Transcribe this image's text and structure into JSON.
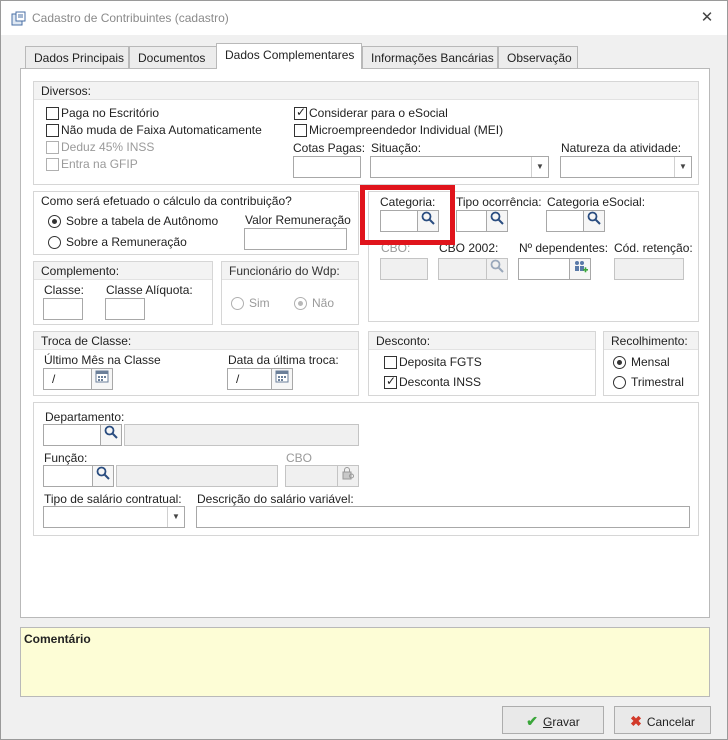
{
  "window": {
    "title": "Cadastro de Contribuintes (cadastro)",
    "close": "✕"
  },
  "tabs": [
    {
      "label": "Dados Principais",
      "active": false
    },
    {
      "label": "Documentos",
      "active": false
    },
    {
      "label": "Dados Complementares",
      "active": true
    },
    {
      "label": "Informações Bancárias",
      "active": false
    },
    {
      "label": "Observação",
      "active": false
    }
  ],
  "diversos": {
    "title": "Diversos:",
    "checkboxes": [
      {
        "label": "Paga no Escritório",
        "checked": false,
        "enabled": true
      },
      {
        "label": "Não muda de Faixa Automaticamente",
        "checked": false,
        "enabled": true
      },
      {
        "label": "Deduz 45% INSS",
        "checked": false,
        "enabled": false
      },
      {
        "label": "Entra na GFIP",
        "checked": false,
        "enabled": false
      },
      {
        "label": "Considerar para o eSocial",
        "checked": true,
        "enabled": true
      },
      {
        "label": "Microempreendedor Individual (MEI)",
        "checked": false,
        "enabled": true
      }
    ],
    "cotas_label": "Cotas Pagas:",
    "situacao_label": "Situação:",
    "natureza_label": "Natureza da atividade:"
  },
  "calculo": {
    "title": "Como será efetuado o cálculo da contribuição?",
    "options": [
      {
        "label": "Sobre a tabela de Autônomo",
        "selected": true
      },
      {
        "label": "Sobre a Remuneração",
        "selected": false
      }
    ],
    "valor_label": "Valor Remuneração"
  },
  "categoria": {
    "categoria_label": "Categoria:",
    "tipo_label": "Tipo ocorrência:",
    "esocial_label": "Categoria eSocial:",
    "cbo_label": "CBO:",
    "cbo2002_label": "CBO 2002:",
    "dependentes_label": "Nº dependentes:",
    "retencao_label": "Cód. retenção:"
  },
  "complemento": {
    "title": "Complemento:",
    "classe_label": "Classe:",
    "aliquota_label": "Classe Alíquota:"
  },
  "funcionario": {
    "title": "Funcionário do Wdp:",
    "options": [
      {
        "label": "Sim",
        "selected": false
      },
      {
        "label": "Não",
        "selected": true
      }
    ]
  },
  "troca": {
    "title": "Troca de Classe:",
    "ultimo_label": "Último Mês na Classe",
    "ultimo_value": "/",
    "data_label": "Data da última troca:",
    "data_value": "/"
  },
  "desconto": {
    "title": "Desconto:",
    "checkboxes": [
      {
        "label": "Deposita FGTS",
        "checked": false
      },
      {
        "label": "Desconta INSS",
        "checked": true
      }
    ]
  },
  "recolhimento": {
    "title": "Recolhimento:",
    "options": [
      {
        "label": "Mensal",
        "selected": true
      },
      {
        "label": "Trimestral",
        "selected": false
      }
    ]
  },
  "outros": {
    "departamento_label": "Departamento:",
    "funcao_label": "Função:",
    "cbo_label": "CBO",
    "tipo_salario_label": "Tipo de salário contratual:",
    "descricao_label": "Descrição do salário variável:"
  },
  "comentario": {
    "label": "Comentário"
  },
  "buttons": {
    "gravar_prefix": "G",
    "gravar_rest": "ravar",
    "cancelar_prefix": "",
    "cancelar_rest": "Cancelar"
  },
  "colors": {
    "highlight": "#e0141c",
    "comment_bg": "#fdfdd6",
    "check_green": "#3aa63a",
    "cancel_red": "#d23a2a"
  }
}
